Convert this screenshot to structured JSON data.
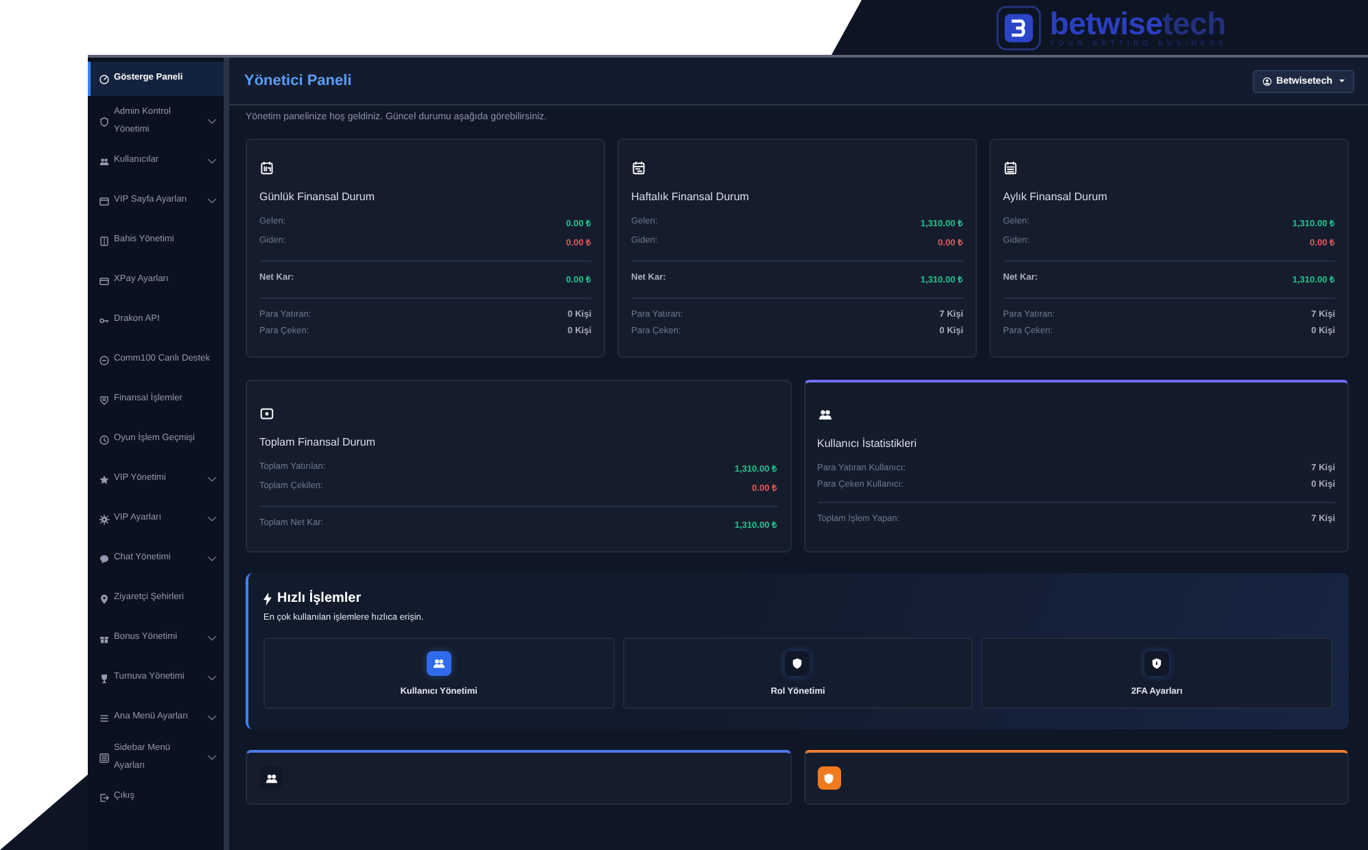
{
  "logo": {
    "wordmark": [
      "betwise",
      "tech"
    ],
    "tagline": "YOUR BETTING BUSINESS"
  },
  "sidebar": {
    "items": [
      {
        "label": "Gösterge Paneli",
        "kind": "gauge",
        "has_submenu": false,
        "selected": true
      },
      {
        "label": "Admin Kontrol Yönetimi",
        "kind": "shield",
        "has_submenu": true,
        "selected": false
      },
      {
        "label": "Kullanıcılar",
        "kind": "users",
        "has_submenu": true,
        "selected": false
      },
      {
        "label": "VIP Sayfa Ayarları",
        "kind": "window",
        "has_submenu": true,
        "selected": false
      },
      {
        "label": "Bahis Yönetimi",
        "kind": "list",
        "has_submenu": false,
        "selected": false
      },
      {
        "label": "XPay Ayarları",
        "kind": "card",
        "has_submenu": false,
        "selected": false
      },
      {
        "label": "Drakon API",
        "kind": "key",
        "has_submenu": false,
        "selected": false
      },
      {
        "label": "Comm100 Canlı Destek",
        "kind": "chat",
        "has_submenu": false,
        "selected": false
      },
      {
        "label": "Finansal İşlemler",
        "kind": "money",
        "has_submenu": false,
        "selected": false
      },
      {
        "label": "Oyun İşlem Geçmişi",
        "kind": "clock",
        "has_submenu": false,
        "selected": false
      },
      {
        "label": "VIP Yönetimi",
        "kind": "star",
        "has_submenu": true,
        "selected": false
      },
      {
        "label": "VIP Ayarları",
        "kind": "gear",
        "has_submenu": true,
        "selected": false
      },
      {
        "label": "Chat Yönetimi",
        "kind": "bubble",
        "has_submenu": true,
        "selected": false
      },
      {
        "label": "Ziyaretçi Şehirleri",
        "kind": "pin",
        "has_submenu": false,
        "selected": false
      },
      {
        "label": "Bonus Yönetimi",
        "kind": "gift",
        "has_submenu": true,
        "selected": false
      },
      {
        "label": "Turnuva Yönetimi",
        "kind": "trophy",
        "has_submenu": true,
        "selected": false
      },
      {
        "label": "Ana Menü Ayarları",
        "kind": "menu",
        "has_submenu": true,
        "selected": false
      },
      {
        "label": "Sidebar Menü Ayarları",
        "kind": "sidebar",
        "has_submenu": true,
        "selected": false
      },
      {
        "label": "Çıkış",
        "kind": "logout",
        "has_submenu": false,
        "selected": false
      }
    ]
  },
  "topbar": {
    "title": "Yönetici Paneli",
    "user_button": "Betwisetech"
  },
  "welcome": "Yönetim panelinize hoş geldiniz. Güncel durumu aşağıda görebilirsiniz.",
  "summary_cards": [
    {
      "kind": "calendar-day",
      "title": "Günlük Finansal Durum",
      "groups": [
        [
          {
            "label": "Gelen:",
            "value": "0.00 ₺",
            "kind": "positive"
          },
          {
            "label": "Giden:",
            "value": "0.00 ₺",
            "kind": "negative"
          }
        ],
        [
          {
            "label": "Net Kar:",
            "value": "0.00 ₺",
            "kind": "total"
          }
        ],
        [
          {
            "label": "Para Yatıran:",
            "value": "0 Kişi",
            "kind": "neutral"
          },
          {
            "label": "Para Çeken:",
            "value": "0 Kişi",
            "kind": "neutral"
          }
        ]
      ]
    },
    {
      "kind": "calendar-week",
      "title": "Haftalık Finansal Durum",
      "groups": [
        [
          {
            "label": "Gelen:",
            "value": "1,310.00 ₺",
            "kind": "positive"
          },
          {
            "label": "Giden:",
            "value": "0.00 ₺",
            "kind": "negative"
          }
        ],
        [
          {
            "label": "Net Kar:",
            "value": "1,310.00 ₺",
            "kind": "total"
          }
        ],
        [
          {
            "label": "Para Yatıran:",
            "value": "7 Kişi",
            "kind": "neutral"
          },
          {
            "label": "Para Çeken:",
            "value": "0 Kişi",
            "kind": "neutral"
          }
        ]
      ]
    },
    {
      "kind": "calendar-month",
      "title": "Aylık Finansal Durum",
      "groups": [
        [
          {
            "label": "Gelen:",
            "value": "1,310.00 ₺",
            "kind": "positive"
          },
          {
            "label": "Giden:",
            "value": "0.00 ₺",
            "kind": "negative"
          }
        ],
        [
          {
            "label": "Net Kar:",
            "value": "1,310.00 ₺",
            "kind": "total"
          }
        ],
        [
          {
            "label": "Para Yatıran:",
            "value": "7 Kişi",
            "kind": "neutral"
          },
          {
            "label": "Para Çeken:",
            "value": "0 Kişi",
            "kind": "neutral"
          }
        ]
      ]
    }
  ],
  "total_cards": [
    {
      "kind": "cash",
      "accent": false,
      "title": "Toplam Finansal Durum",
      "groups": [
        [
          {
            "label": "Toplam Yatırılan:",
            "value": "1,310.00 ₺",
            "kind": "positive"
          },
          {
            "label": "Toplam Çekilen:",
            "value": "0.00 ₺",
            "kind": "negative"
          }
        ],
        [
          {
            "label": "Toplam Net Kar:",
            "value": "1,310.00 ₺",
            "kind": "positive"
          }
        ]
      ]
    },
    {
      "kind": "users",
      "accent": true,
      "title": "Kullanıcı İstatistikleri",
      "groups": [
        [
          {
            "label": "Para Yatıran Kullanıcı:",
            "value": "7 Kişi",
            "kind": "neutral"
          },
          {
            "label": "Para Çeken Kullanıcı:",
            "value": "0 Kişi",
            "kind": "neutral"
          }
        ],
        [
          {
            "label": "Toplam İşlem Yapan:",
            "value": "7 Kişi",
            "kind": "neutral"
          }
        ]
      ]
    }
  ],
  "quick_actions": {
    "title": "Hızlı İşlemler",
    "subtitle": "En çok kullanılan işlemlere hızlıca erişin.",
    "items": [
      {
        "label": "Kullanıcı Yönetimi",
        "kind": "users",
        "color": "#2f6bec"
      },
      {
        "label": "Rol Yönetimi",
        "kind": "shield",
        "color": "#101828"
      },
      {
        "label": "2FA Ayarları",
        "kind": "shield-lock",
        "color": "#101828"
      }
    ]
  },
  "bottom_cards": [
    {
      "kind": "users"
    },
    {
      "kind": "security"
    }
  ]
}
